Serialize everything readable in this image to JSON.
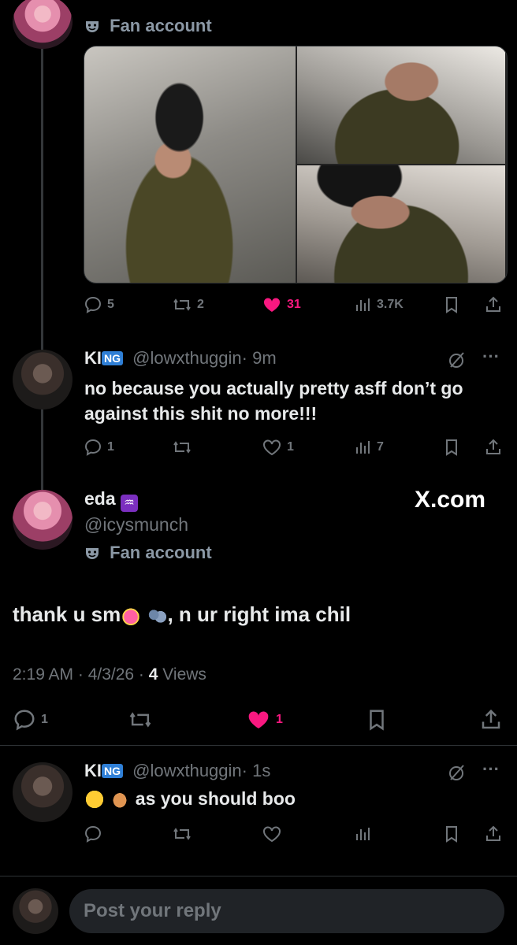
{
  "thread_top": {
    "fan_label": "Fan account",
    "stats": {
      "replies": "5",
      "reposts": "2",
      "likes": "31",
      "views": "3.7K"
    }
  },
  "reply1": {
    "name": "KI",
    "badge": "NG",
    "handle": "@lowxthuggin",
    "time": "· 9m",
    "text": "no because you actually pretty asff don’t go against this shit no more!!!",
    "stats": {
      "replies": "1",
      "likes": "1",
      "views": "7"
    }
  },
  "main": {
    "name": "eda",
    "sign": "♒",
    "handle": "@icysmunch",
    "fan_label": "Fan account",
    "xcom": "X.com",
    "text_a": "thank u sm",
    "text_b": ", n ur right ima chil",
    "meta_time": "2:19 AM · 4/3/26 · ",
    "meta_views_count": "4",
    "meta_views_label": " Views",
    "stats": {
      "replies": "1",
      "likes": "1"
    }
  },
  "reply2": {
    "name": "KI",
    "badge": "NG",
    "handle": "@lowxthuggin",
    "time": "· 1s",
    "text": "as you should boo"
  },
  "composer": {
    "placeholder": "Post your reply"
  },
  "colors": {
    "accent_like": "#f91880",
    "muted": "#71767b",
    "bg": "#000000",
    "divider": "#2f3336"
  }
}
